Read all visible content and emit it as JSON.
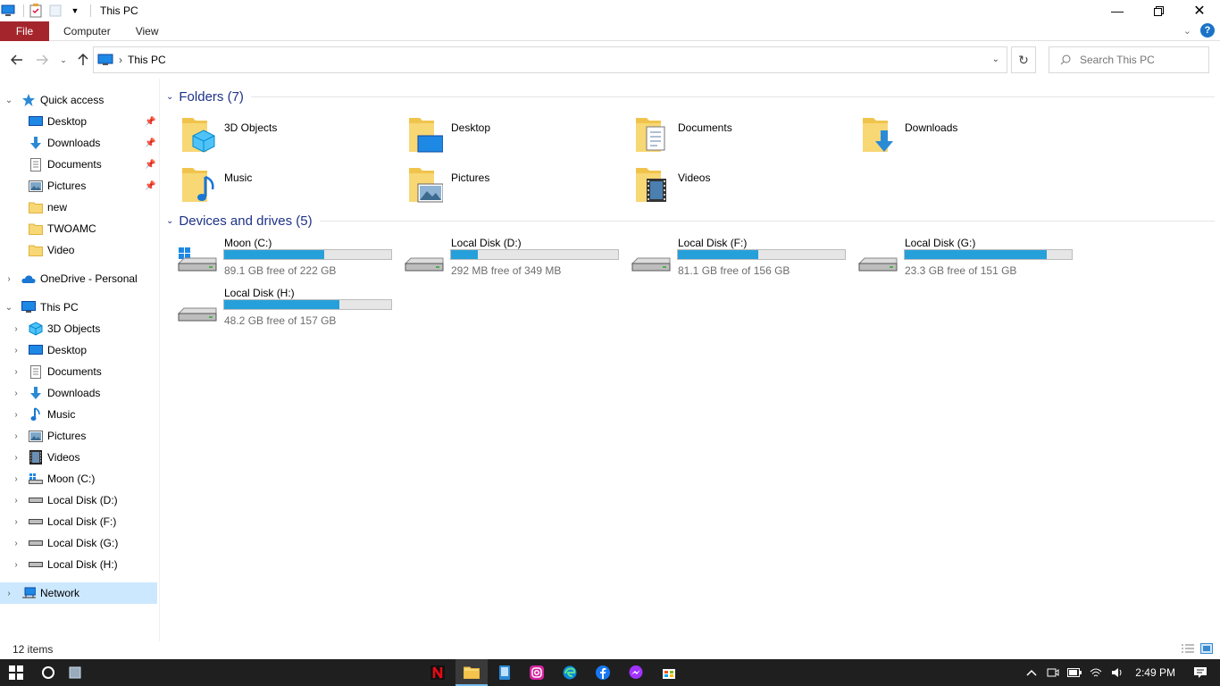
{
  "window": {
    "title": "This PC"
  },
  "ribbon": {
    "file": "File",
    "tabs": [
      "Computer",
      "View"
    ]
  },
  "address": {
    "path": "This PC",
    "search_placeholder": "Search This PC"
  },
  "nav": {
    "quick_access": "Quick access",
    "quick_items": [
      {
        "label": "Desktop",
        "icon": "desktop-icon",
        "pinned": true
      },
      {
        "label": "Downloads",
        "icon": "downloads-icon",
        "pinned": true
      },
      {
        "label": "Documents",
        "icon": "documents-icon",
        "pinned": true
      },
      {
        "label": "Pictures",
        "icon": "pictures-icon",
        "pinned": true
      },
      {
        "label": "new",
        "icon": "folder-icon",
        "pinned": false
      },
      {
        "label": "TWOAMC",
        "icon": "folder-icon",
        "pinned": false
      },
      {
        "label": "Video",
        "icon": "folder-icon",
        "pinned": false
      }
    ],
    "onedrive": "OneDrive - Personal",
    "this_pc": "This PC",
    "pc_items": [
      {
        "label": "3D Objects",
        "icon": "3d-objects-icon"
      },
      {
        "label": "Desktop",
        "icon": "desktop-icon"
      },
      {
        "label": "Documents",
        "icon": "documents-icon"
      },
      {
        "label": "Downloads",
        "icon": "downloads-icon"
      },
      {
        "label": "Music",
        "icon": "music-icon"
      },
      {
        "label": "Pictures",
        "icon": "pictures-icon"
      },
      {
        "label": "Videos",
        "icon": "videos-icon"
      },
      {
        "label": "Moon (C:)",
        "icon": "windows-drive-icon"
      },
      {
        "label": "Local Disk (D:)",
        "icon": "drive-icon"
      },
      {
        "label": "Local Disk (F:)",
        "icon": "drive-icon"
      },
      {
        "label": "Local Disk (G:)",
        "icon": "drive-icon"
      },
      {
        "label": "Local Disk (H:)",
        "icon": "drive-icon"
      }
    ],
    "network": "Network"
  },
  "folders": {
    "header": "Folders (7)",
    "items": [
      "3D Objects",
      "Desktop",
      "Documents",
      "Downloads",
      "Music",
      "Pictures",
      "Videos"
    ]
  },
  "drives": {
    "header": "Devices and drives (5)",
    "items": [
      {
        "name": "Moon (C:)",
        "free": "89.1 GB free of 222 GB",
        "used_fraction": 0.6,
        "windows": true
      },
      {
        "name": "Local Disk (D:)",
        "free": "292 MB free of 349 MB",
        "used_fraction": 0.16,
        "windows": false
      },
      {
        "name": "Local Disk (F:)",
        "free": "81.1 GB free of 156 GB",
        "used_fraction": 0.48,
        "windows": false
      },
      {
        "name": "Local Disk (G:)",
        "free": "23.3 GB free of 151 GB",
        "used_fraction": 0.85,
        "windows": false
      },
      {
        "name": "Local Disk (H:)",
        "free": "48.2 GB free of 157 GB",
        "used_fraction": 0.69,
        "windows": false
      }
    ]
  },
  "status": {
    "count": "12 items"
  },
  "taskbar": {
    "time": "2:49 PM",
    "apps": [
      "netflix-icon",
      "file-explorer-icon",
      "notes-icon",
      "instagram-icon",
      "edge-icon",
      "facebook-icon",
      "messenger-icon",
      "store-icon"
    ]
  },
  "colors": {
    "file_tab": "#a4262c",
    "drive_fill": "#26a0da",
    "group_header": "#1e3287",
    "selection": "#cce8ff"
  }
}
